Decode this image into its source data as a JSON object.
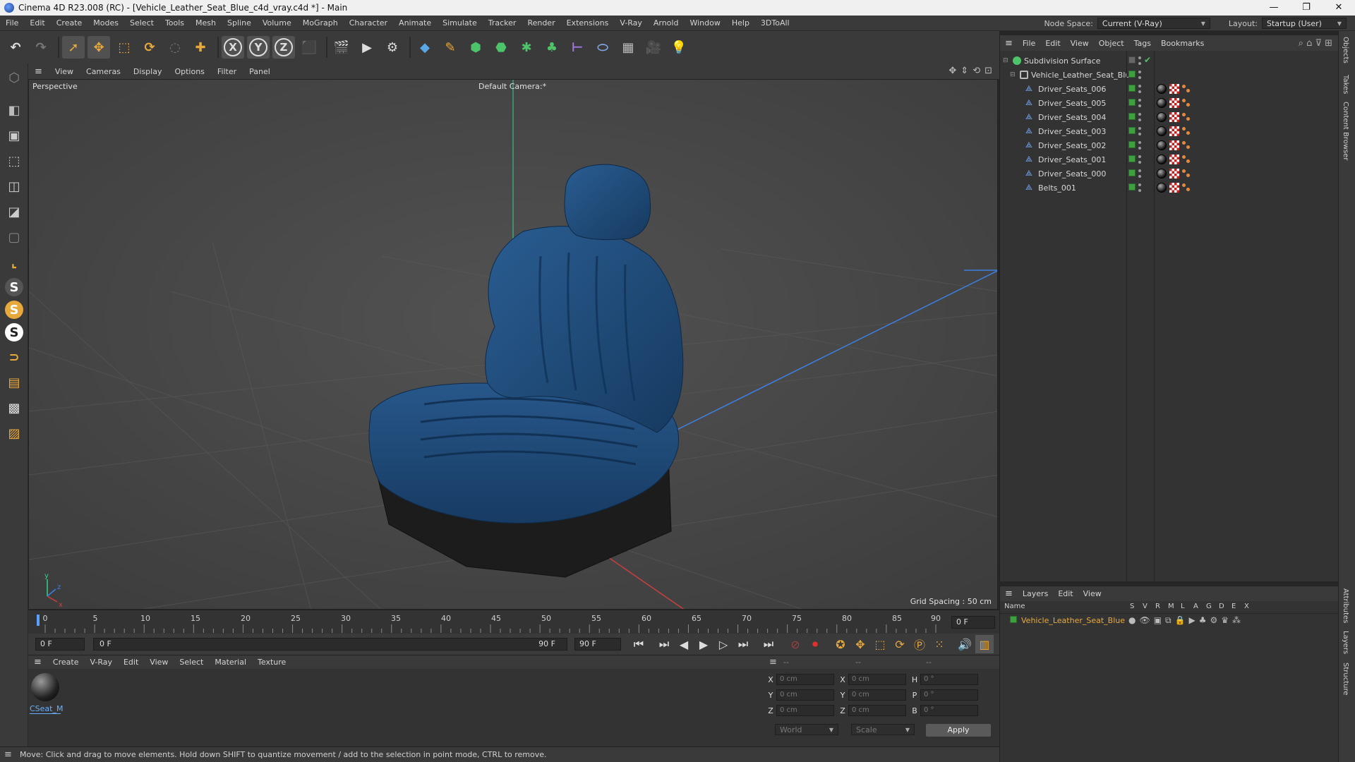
{
  "window": {
    "title": "Cinema 4D R23.008 (RC) - [Vehicle_Leather_Seat_Blue_c4d_vray.c4d *] - Main",
    "controls": [
      "—",
      "❐",
      "✕"
    ]
  },
  "menubar": {
    "items": [
      "File",
      "Edit",
      "Create",
      "Modes",
      "Select",
      "Tools",
      "Mesh",
      "Spline",
      "Volume",
      "MoGraph",
      "Character",
      "Animate",
      "Simulate",
      "Tracker",
      "Render",
      "Extensions",
      "V-Ray",
      "Arnold",
      "Window",
      "Help",
      "3DToAll"
    ],
    "node_space_label": "Node Space:",
    "node_space_value": "Current (V-Ray)",
    "layout_label": "Layout:",
    "layout_value": "Startup (User)"
  },
  "toolbar": {
    "icons": [
      "undo-icon",
      "redo-icon",
      "select-icon",
      "move-icon",
      "scale-icon",
      "rotate-icon",
      "live-select-icon",
      "add-icon",
      "x-axis-icon",
      "y-axis-icon",
      "z-axis-icon",
      "coordinate-system-icon",
      "render-region-icon",
      "render-view-icon",
      "render-settings-icon",
      "cube-icon",
      "pen-icon",
      "subdivision-icon",
      "extrude-icon",
      "cloner-icon",
      "generator-icon",
      "deformer-icon",
      "field-icon",
      "floor-icon",
      "camera-icon",
      "light-icon"
    ],
    "axis_labels": [
      "X",
      "Y",
      "Z"
    ]
  },
  "left_palette": {
    "icons": [
      "model-mode-icon",
      "texture-mode-icon",
      "object-mode-icon",
      "points-mode-icon",
      "polygons-mode-icon",
      "uv-mode-icon",
      "workplane-icon",
      "snap-s-icon",
      "snap-s2-icon",
      "snap-s3-icon",
      "magnet-icon",
      "grid-icon",
      "checker-icon",
      "quantize-icon"
    ]
  },
  "viewport": {
    "menu": [
      "View",
      "Cameras",
      "Display",
      "Options",
      "Filter",
      "Panel"
    ],
    "label": "Perspective",
    "camera": "Default Camera",
    "camera_suffix": ":*",
    "grid_spacing": "Grid Spacing : 50 cm",
    "colors": {
      "background": "#4a4a4a",
      "seat": "#1f4a78",
      "base": "#1c1c1c"
    }
  },
  "timeline": {
    "ticks": [
      "0",
      "5",
      "10",
      "15",
      "20",
      "25",
      "30",
      "35",
      "40",
      "45",
      "50",
      "55",
      "60",
      "65",
      "70",
      "75",
      "80",
      "85",
      "90"
    ],
    "current_frame": "0 F",
    "start": "0 F",
    "range_start": "0 F",
    "range_end": "90 F",
    "end": "90 F"
  },
  "material_manager": {
    "menu": [
      "Create",
      "V-Ray",
      "Edit",
      "View",
      "Select",
      "Material",
      "Texture"
    ],
    "materials": [
      {
        "name": "CSeat_M"
      }
    ]
  },
  "coordinates": {
    "header": [
      "--",
      "--",
      "--"
    ],
    "rows": [
      {
        "a": "X",
        "a_val": "0 cm",
        "b": "X",
        "b_val": "0 cm",
        "c": "H",
        "c_val": "0 °"
      },
      {
        "a": "Y",
        "a_val": "0 cm",
        "b": "Y",
        "b_val": "0 cm",
        "c": "P",
        "c_val": "0 °"
      },
      {
        "a": "Z",
        "a_val": "0 cm",
        "b": "Z",
        "b_val": "0 cm",
        "c": "B",
        "c_val": "0 °"
      }
    ],
    "space": "World",
    "mode": "Scale",
    "apply": "Apply"
  },
  "status": {
    "message": "Move: Click and drag to move elements. Hold down SHIFT to quantize movement / add to the selection in point mode, CTRL to remove."
  },
  "object_manager": {
    "menu": [
      "File",
      "Edit",
      "View",
      "Object",
      "Tags",
      "Bookmarks"
    ],
    "objects": [
      {
        "name": "Subdivision Surface",
        "level": 0
      },
      {
        "name": "Vehicle_Leather_Seat_Blue",
        "level": 1
      },
      {
        "name": "Driver_Seats_006",
        "level": 2
      },
      {
        "name": "Driver_Seats_005",
        "level": 2
      },
      {
        "name": "Driver_Seats_004",
        "level": 2
      },
      {
        "name": "Driver_Seats_003",
        "level": 2
      },
      {
        "name": "Driver_Seats_002",
        "level": 2
      },
      {
        "name": "Driver_Seats_001",
        "level": 2
      },
      {
        "name": "Driver_Seats_000",
        "level": 2
      },
      {
        "name": "Belts_001",
        "level": 2
      }
    ]
  },
  "layer_manager": {
    "menu": [
      "Layers",
      "Edit",
      "View"
    ],
    "columns": [
      "Name",
      "S",
      "V",
      "R",
      "M",
      "L",
      "A",
      "G",
      "D",
      "E",
      "X"
    ],
    "layers": [
      {
        "name": "Vehicle_Leather_Seat_Blue",
        "color": "#e8a93c"
      }
    ]
  },
  "side_tabs": [
    "Objects",
    "Takes",
    "Content Browser",
    "Attributes",
    "Layers",
    "Structure"
  ]
}
